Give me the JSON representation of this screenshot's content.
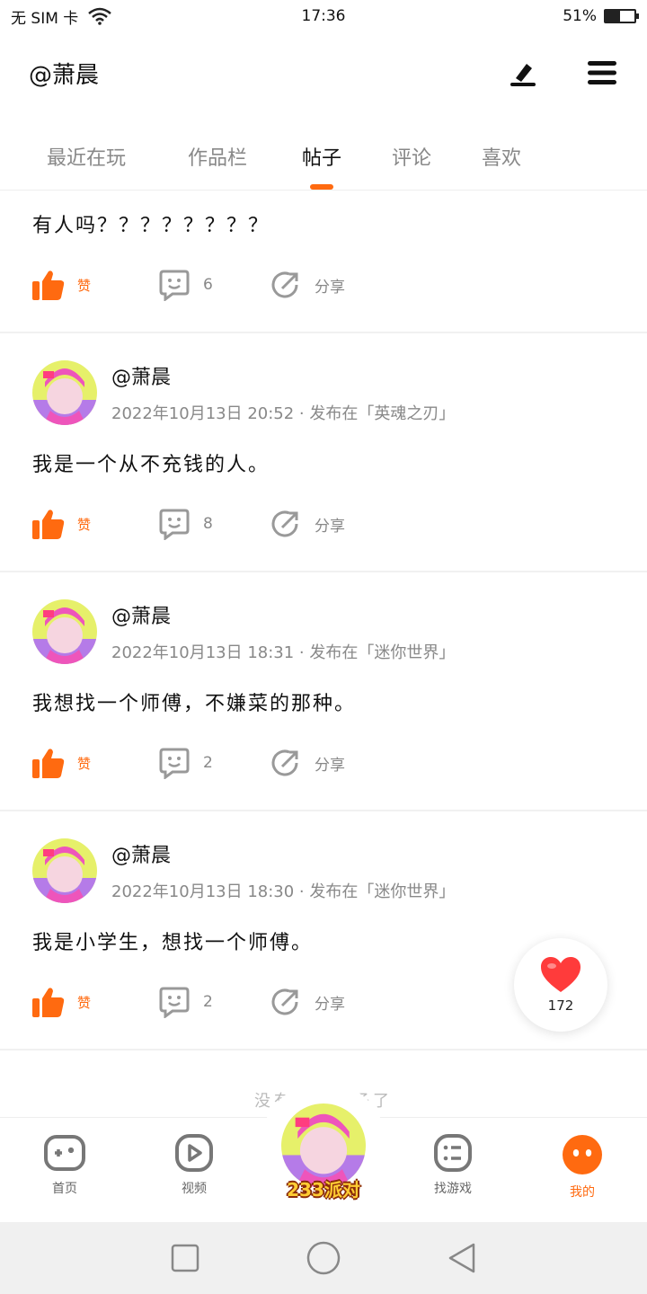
{
  "status": {
    "sim": "无 SIM 卡",
    "time": "17:36",
    "battery_text": "51%",
    "battery_level": 0.51
  },
  "header": {
    "username": "@萧晨"
  },
  "tabs": [
    {
      "label": "最近在玩",
      "active": false
    },
    {
      "label": "作品栏",
      "active": false
    },
    {
      "label": "帖子",
      "active": true
    },
    {
      "label": "评论",
      "active": false
    },
    {
      "label": "喜欢",
      "active": false
    }
  ],
  "posts": [
    {
      "partial": true,
      "text": "有人吗？？？？？？？？",
      "like_label": "赞",
      "comments": "6",
      "share_label": "分享"
    },
    {
      "author": "@萧晨",
      "meta": "2022年10月13日 20:52 · 发布在「英魂之刃」",
      "text": "我是一个从不充钱的人。",
      "like_label": "赞",
      "comments": "8",
      "share_label": "分享"
    },
    {
      "author": "@萧晨",
      "meta": "2022年10月13日 18:31 · 发布在「迷你世界」",
      "text": "我想找一个师傅，不嫌菜的那种。",
      "like_label": "赞",
      "comments": "2",
      "share_label": "分享"
    },
    {
      "author": "@萧晨",
      "meta": "2022年10月13日 18:30 · 发布在「迷你世界」",
      "text": "我是小学生，想找一个师傅。",
      "like_label": "赞",
      "comments": "2",
      "share_label": "分享"
    }
  ],
  "feed_end": "没有更多帖子了",
  "float_like": {
    "count": "172"
  },
  "bottom_nav": {
    "items": [
      {
        "label": "首页",
        "icon": "gamepad-icon",
        "active": false
      },
      {
        "label": "视频",
        "icon": "play-icon",
        "active": false
      },
      {
        "label": "找游戏",
        "icon": "list-icon",
        "active": false
      },
      {
        "label": "我的",
        "icon": "face-icon",
        "active": true
      }
    ],
    "center_label": "233派对"
  },
  "colors": {
    "accent": "#ff6a10",
    "heart": "#ff3b3b"
  }
}
